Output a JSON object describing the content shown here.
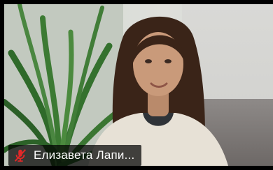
{
  "participant": {
    "name": "Елизавета Лапи...",
    "mic_state": "muted"
  },
  "icons": {
    "mic": "microphone-muted-icon"
  },
  "colors": {
    "mute_red": "#e02828",
    "name_bar_bg": "#000000",
    "name_text": "#ffffff",
    "frame": "#000000"
  }
}
